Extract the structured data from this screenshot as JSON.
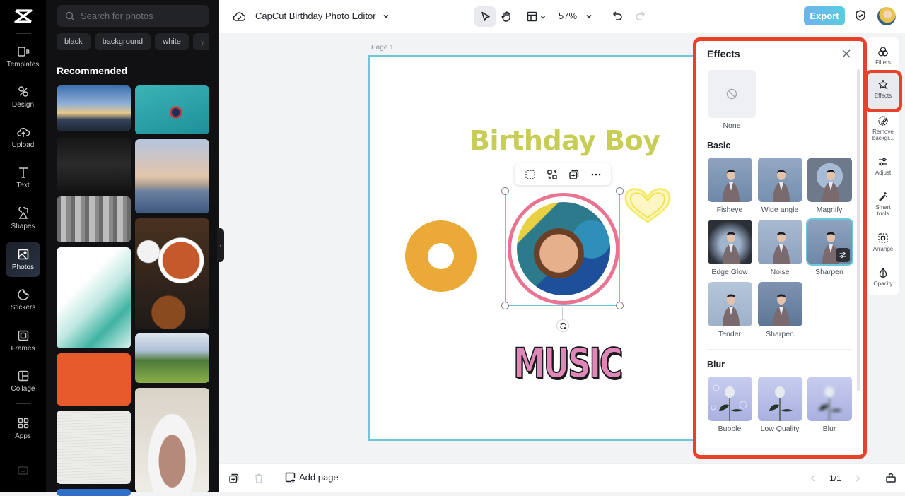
{
  "rail": {
    "items": [
      {
        "label": "Templates",
        "icon": "templates-icon"
      },
      {
        "label": "Design",
        "icon": "design-icon"
      },
      {
        "label": "Upload",
        "icon": "upload-icon"
      },
      {
        "label": "Text",
        "icon": "text-icon"
      },
      {
        "label": "Shapes",
        "icon": "shapes-icon"
      },
      {
        "label": "Photos",
        "icon": "photos-icon",
        "active": true
      },
      {
        "label": "Stickers",
        "icon": "stickers-icon"
      },
      {
        "label": "Frames",
        "icon": "frames-icon"
      },
      {
        "label": "Collage",
        "icon": "collage-icon"
      },
      {
        "label": "Apps",
        "icon": "apps-icon"
      }
    ]
  },
  "photos_panel": {
    "search_placeholder": "Search for photos",
    "chips": [
      "black",
      "background",
      "white",
      "y"
    ],
    "section_title": "Recommended",
    "thumbnails": [
      "city skyline clouds",
      "boat on turquoise sea",
      "dark wood texture",
      "new york skyline",
      "temple stone carvings",
      "ramen meal",
      "teal abstract waves",
      "fried chicken",
      "orange paper",
      "green hills landscape",
      "white paper texture",
      "meat with mushrooms plate",
      "blue"
    ]
  },
  "topbar": {
    "doc_title": "CapCut Birthday Photo Editor",
    "zoom": "57%",
    "export_label": "Export",
    "accent": "#5ccbe0"
  },
  "canvas": {
    "page_label": "Page 1",
    "heading_text": "Birthday Boy",
    "music_text": "MUSIC",
    "colors": {
      "heading": "#c7cd55",
      "donut": "#ebaa38",
      "ring": "#ea7390",
      "music": "#df87b8",
      "selection": "#6cc7dc"
    }
  },
  "effects_panel": {
    "title": "Effects",
    "none_label": "None",
    "sections": [
      {
        "title": "Basic",
        "items": [
          "Fisheye",
          "Wide angle",
          "Magnify",
          "Edge Glow",
          "Noise",
          "Sharpen",
          "Tender",
          "Sharpen"
        ],
        "selected_index": 5
      },
      {
        "title": "Blur",
        "items": [
          "Bubble",
          "Low Quality",
          "Blur"
        ]
      }
    ]
  },
  "side_tools": {
    "items": [
      {
        "label": "Filters",
        "icon": "filters-icon"
      },
      {
        "label": "Effects",
        "icon": "effects-icon",
        "active": true
      },
      {
        "label": "Remove backgr...",
        "icon": "remove-background-icon"
      },
      {
        "label": "Adjust",
        "icon": "adjust-icon"
      },
      {
        "label": "Smart tools",
        "icon": "smart-tools-icon"
      },
      {
        "label": "Arrange",
        "icon": "arrange-icon"
      },
      {
        "label": "Opacity",
        "icon": "opacity-icon"
      }
    ]
  },
  "bottombar": {
    "add_page_label": "Add page",
    "pager": "1/1"
  },
  "highlight_color": "#e8412a"
}
